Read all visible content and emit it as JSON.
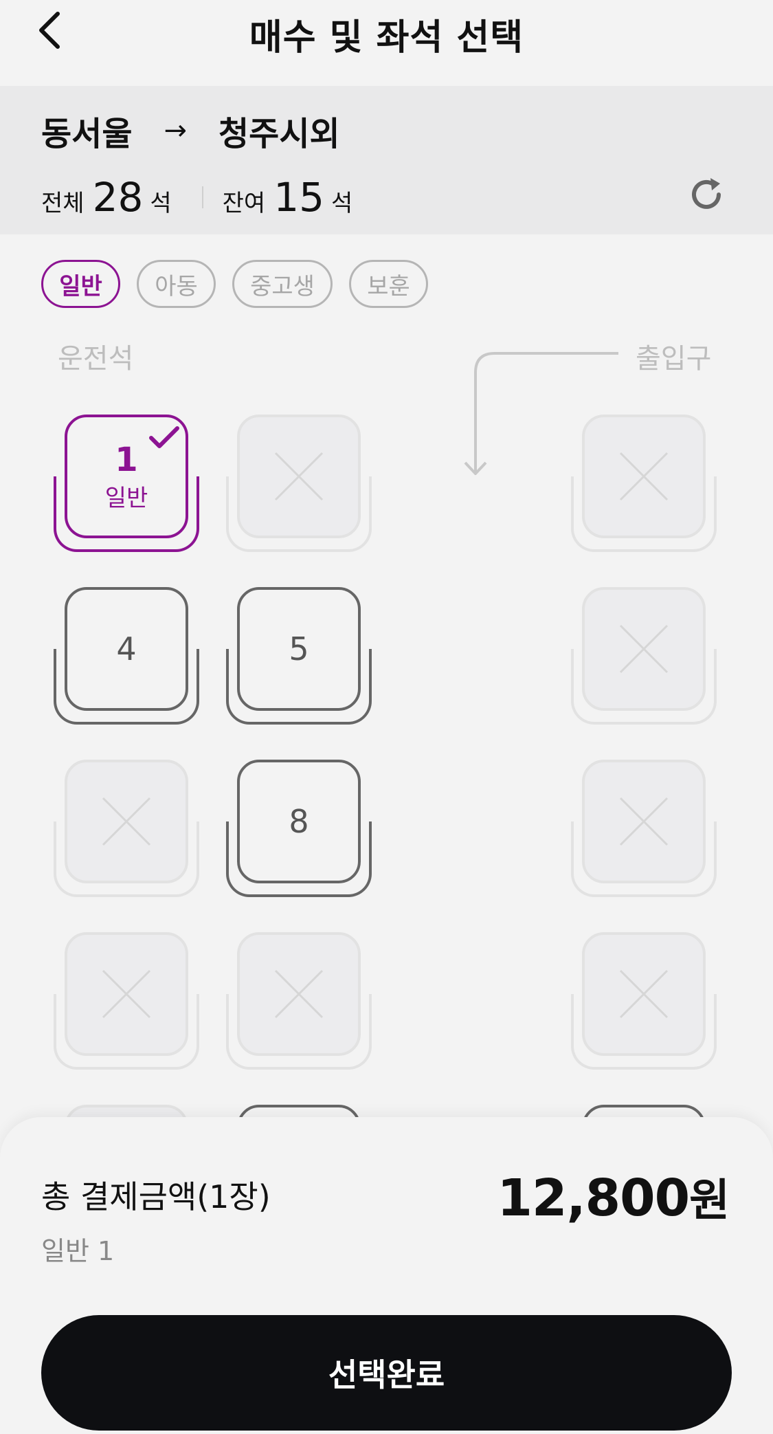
{
  "header": {
    "title": "매수 및 좌석 선택"
  },
  "route": {
    "from": "동서울",
    "arrow": "→",
    "to": "청주시외"
  },
  "counts": {
    "total_label": "전체",
    "total": "28",
    "unit": "석",
    "remain_label": "잔여",
    "remain": "15"
  },
  "passenger_types": [
    "일반",
    "아동",
    "중고생",
    "보훈"
  ],
  "seatmap": {
    "driver_label": "운전석",
    "entrance_label": "출입구",
    "seats": {
      "s1": {
        "num": "1",
        "type": "일반"
      },
      "s4": {
        "num": "4"
      },
      "s5": {
        "num": "5"
      },
      "s8": {
        "num": "8"
      }
    }
  },
  "summary": {
    "total_label": "총 결제금액(1장)",
    "breakdown": "일반 1",
    "amount": "12,800",
    "currency": "원",
    "confirm_label": "선택완료"
  },
  "colors": {
    "accent": "#8c1392",
    "button": "#0e0f12"
  }
}
